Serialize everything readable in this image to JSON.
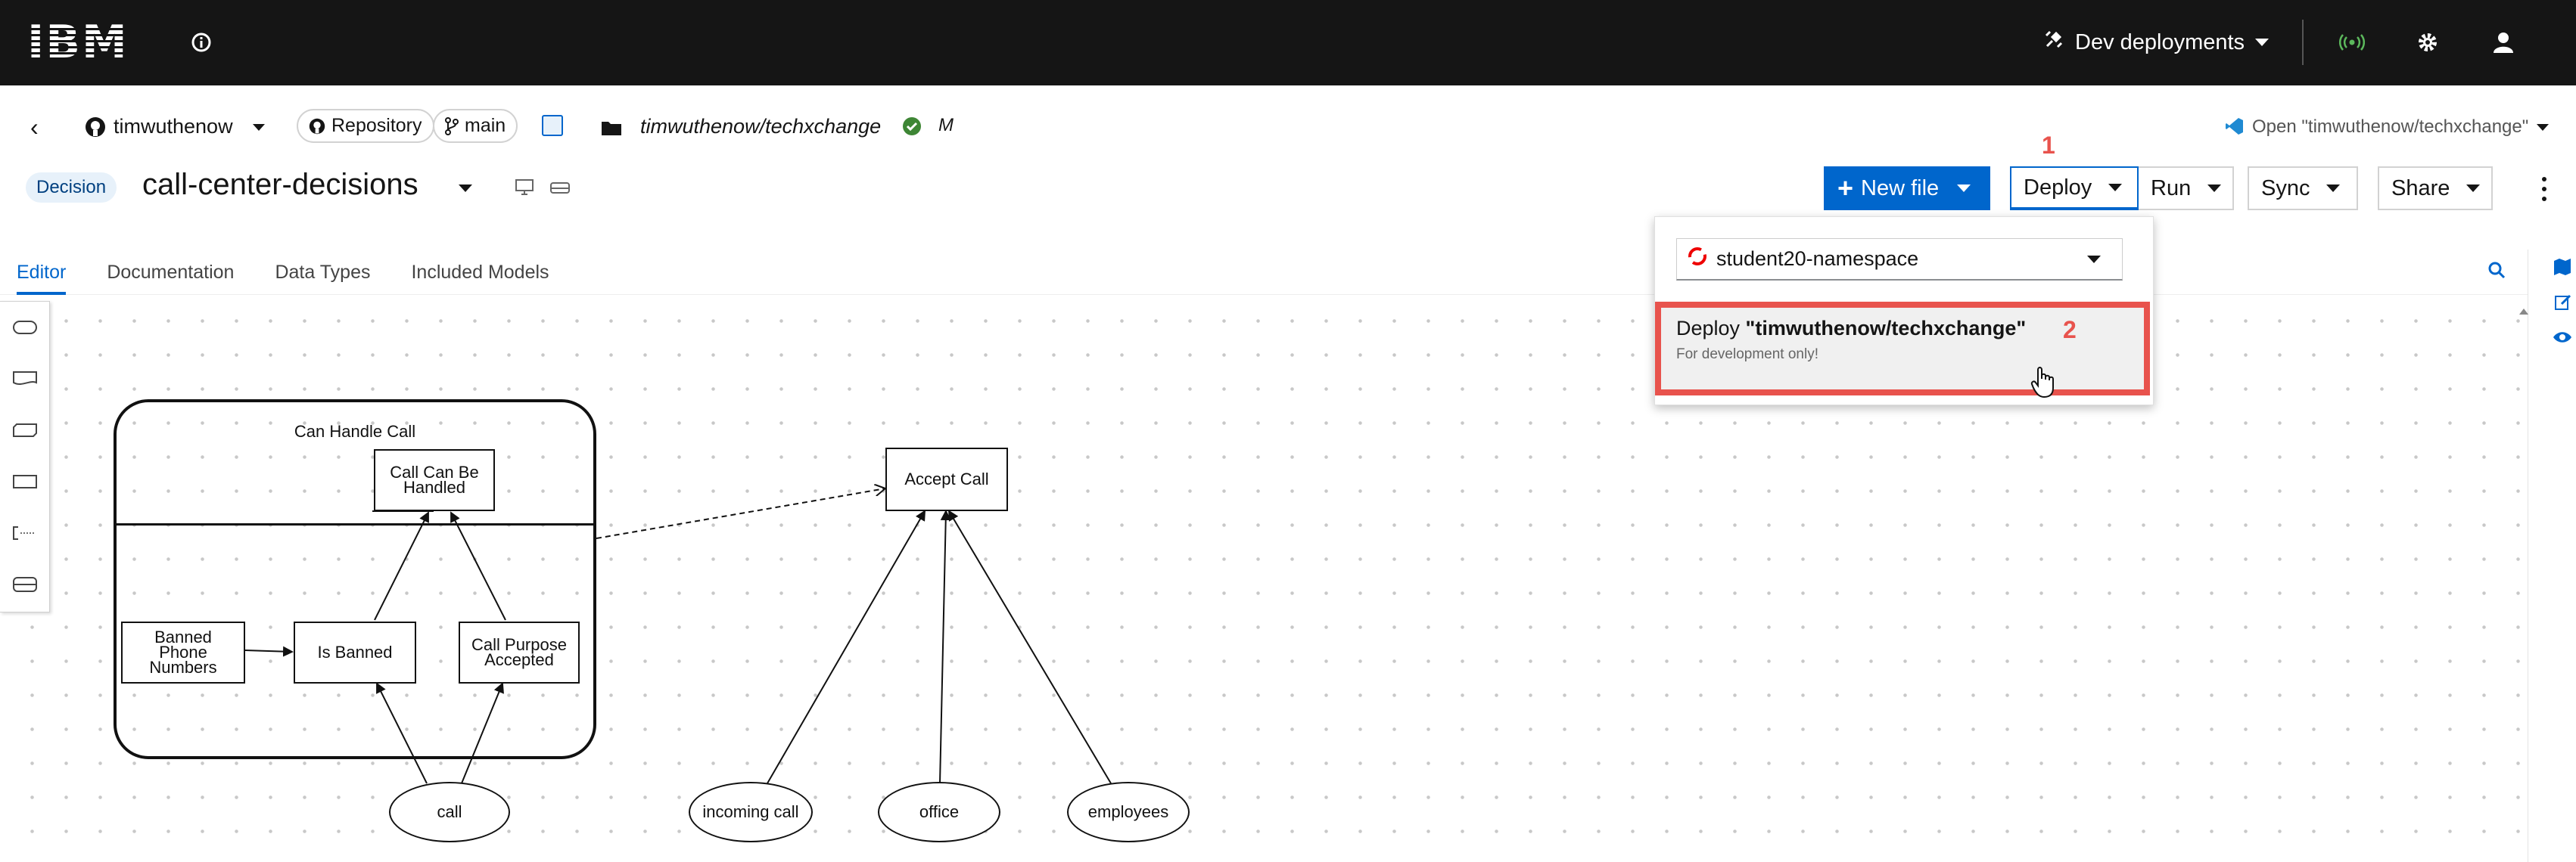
{
  "topbar": {
    "logo": "IBM",
    "dev_deployments_label": "Dev deployments",
    "icons": [
      "info-icon",
      "satellite-icon",
      "broadcast-icon",
      "gear-icon",
      "user-icon"
    ]
  },
  "breadcrumbs": {
    "user": "timwuthenow",
    "repository_label": "Repository",
    "branch": "main",
    "path": "timwuthenow/techxchange",
    "modified_flag": "M",
    "open_vscode_label": "Open \"timwuthenow/techxchange\""
  },
  "file": {
    "badge": "Decision",
    "name": "call-center-decisions"
  },
  "toolbar": {
    "new_file_label": "New file",
    "deploy_label": "Deploy",
    "run_label": "Run",
    "sync_label": "Sync",
    "share_label": "Share"
  },
  "deploy_menu": {
    "namespace": "student20-namespace",
    "deploy_prefix": "Deploy ",
    "deploy_target": "\"timwuthenow/techxchange\"",
    "deploy_note": "For development only!"
  },
  "annotations": {
    "step1": "1",
    "step2": "2"
  },
  "tabs": [
    "Editor",
    "Documentation",
    "Data Types",
    "Included Models"
  ],
  "diagram": {
    "service_title": "Can Handle Call",
    "decision_can_be_handled": "Call Can Be Handled",
    "decision_is_banned": "Is Banned",
    "decision_call_purpose": "Call Purpose Accepted",
    "knowledge_banned_numbers": "Banned Phone Numbers",
    "decision_accept_call": "Accept Call",
    "input_call": "call",
    "input_incoming_call": "incoming call",
    "input_office": "office",
    "input_employees": "employees"
  },
  "colors": {
    "topbar_bg": "#151515",
    "primary_blue": "#0066cc",
    "annotation_red": "#e8534d"
  }
}
